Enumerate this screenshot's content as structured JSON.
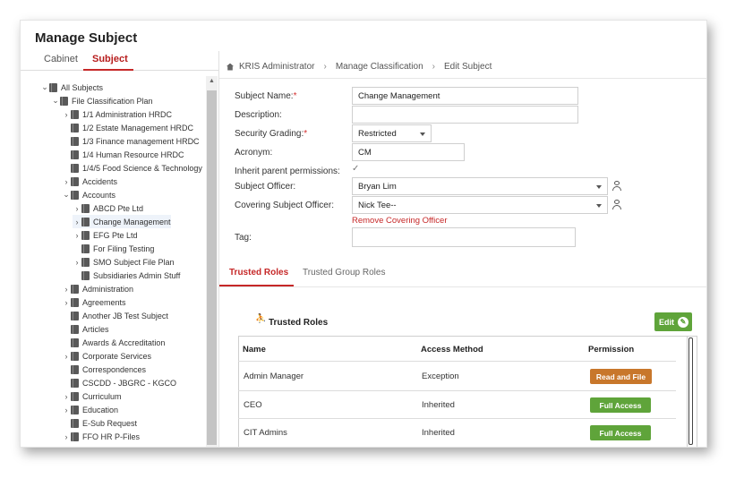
{
  "page": {
    "title": "Manage Subject",
    "left_tabs": [
      "Cabinet",
      "Subject"
    ],
    "active_left_tab": "Subject"
  },
  "tree": {
    "items": [
      {
        "label": "All Subjects",
        "chevron": "v"
      },
      {
        "label": "File Classification Plan",
        "chevron": "v"
      },
      {
        "label": "1/1 Administration HRDC",
        "chevron": ">"
      },
      {
        "label": "1/2 Estate Management HRDC",
        "chevron": ""
      },
      {
        "label": "1/3 Finance management HRDC",
        "chevron": ""
      },
      {
        "label": "1/4 Human Resource HRDC",
        "chevron": ""
      },
      {
        "label": "1/4/5 Food Science & Technology",
        "chevron": ""
      },
      {
        "label": "Accidents",
        "chevron": ">"
      },
      {
        "label": "Accounts",
        "chevron": "v"
      },
      {
        "label": "ABCD Pte Ltd",
        "chevron": ">"
      },
      {
        "label": "Change Management",
        "chevron": ">"
      },
      {
        "label": "EFG Pte Ltd",
        "chevron": ">"
      },
      {
        "label": "For Filing Testing",
        "chevron": ""
      },
      {
        "label": "SMO Subject File Plan",
        "chevron": ">"
      },
      {
        "label": "Subsidiaries Admin Stuff",
        "chevron": ""
      },
      {
        "label": "Administration",
        "chevron": ">"
      },
      {
        "label": "Agreements",
        "chevron": ">"
      },
      {
        "label": "Another JB Test Subject",
        "chevron": ""
      },
      {
        "label": "Articles",
        "chevron": ""
      },
      {
        "label": "Awards & Accreditation",
        "chevron": ""
      },
      {
        "label": "Corporate Services",
        "chevron": ">"
      },
      {
        "label": "Correspondences",
        "chevron": ""
      },
      {
        "label": "CSCDD - JBGRC - KGCO",
        "chevron": ""
      },
      {
        "label": "Curriculum",
        "chevron": ">"
      },
      {
        "label": "Education",
        "chevron": ">"
      },
      {
        "label": "E-Sub Request",
        "chevron": ""
      },
      {
        "label": "FFO HR P-Files",
        "chevron": ">"
      }
    ],
    "selected": "Change Management"
  },
  "breadcrumb": [
    "KRIS Administrator",
    "Manage Classification",
    "Edit Subject"
  ],
  "form": {
    "subject_name": {
      "label": "Subject Name:",
      "required": "*",
      "value": "Change Management"
    },
    "description": {
      "label": "Description:",
      "value": ""
    },
    "security_grading": {
      "label": "Security Grading:",
      "required": "*",
      "value": "Restricted"
    },
    "acronym": {
      "label": "Acronym:",
      "value": "CM"
    },
    "inherit": {
      "label": "Inherit parent permissions:",
      "checked": "✓"
    },
    "subject_officer": {
      "label": "Subject Officer:",
      "value": "Bryan Lim"
    },
    "covering_officer": {
      "label": "Covering Subject Officer:",
      "value": "Nick Tee--"
    },
    "remove_covering": "Remove Covering Officer",
    "tag": {
      "label": "Tag:",
      "value": ""
    }
  },
  "role_tabs": [
    "Trusted Roles",
    "Trusted Group Roles"
  ],
  "trusted_roles": {
    "title": "Trusted Roles",
    "edit_label": "Edit",
    "columns": [
      "Name",
      "Access Method",
      "Permission"
    ],
    "rows": [
      {
        "name": "Admin Manager",
        "method": "Exception",
        "permission": "Read and File",
        "color": "#c8772b"
      },
      {
        "name": "CEO",
        "method": "Inherited",
        "permission": "Full Access",
        "color": "#5fa43a"
      },
      {
        "name": "CIT Admins",
        "method": "Inherited",
        "permission": "Full Access",
        "color": "#5fa43a"
      }
    ]
  },
  "colors": {
    "accent": "#c62828",
    "green": "#5fa43a",
    "orange": "#c8772b"
  }
}
